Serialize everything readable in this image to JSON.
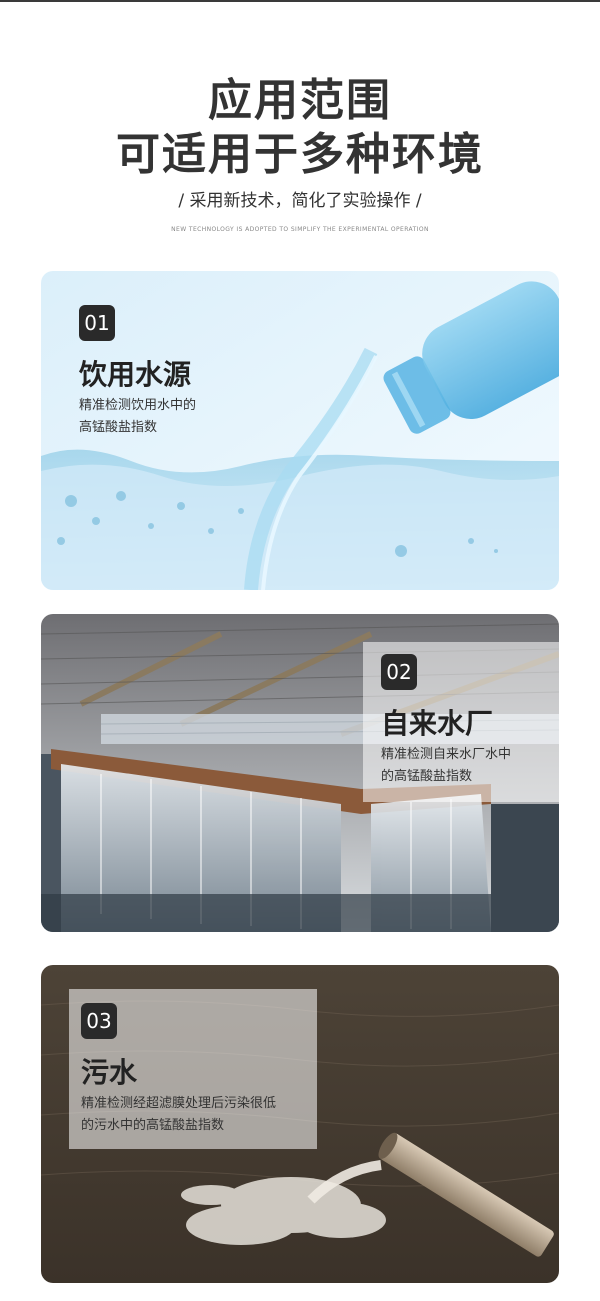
{
  "header": {
    "title_line1": "应用范围",
    "title_line2": "可适用于多种环境",
    "subtitle": "/ 采用新技术，简化了实验操作 /",
    "subtitle_en": "NEW TECHNOLOGY IS ADOPTED TO SIMPLIFY THE EXPERIMENTAL OPERATION"
  },
  "cards": [
    {
      "number": "01",
      "title": "饮用水源",
      "desc_line1": "精准检测饮用水中的",
      "desc_line2": "高锰酸盐指数"
    },
    {
      "number": "02",
      "title": "自来水厂",
      "desc_line1": "精准检测自来水厂水中",
      "desc_line2": "的高锰酸盐指数"
    },
    {
      "number": "03",
      "title": "污水",
      "desc_line1": "精准检测经超滤膜处理后污染很低",
      "desc_line2": "的污水中的高锰酸盐指数"
    }
  ]
}
